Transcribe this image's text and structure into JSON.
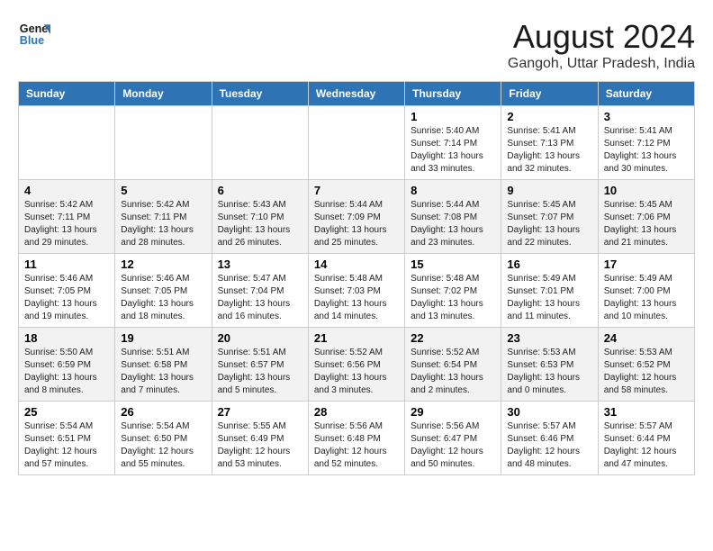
{
  "header": {
    "logo_text_general": "General",
    "logo_text_blue": "Blue",
    "month_year": "August 2024",
    "location": "Gangoh, Uttar Pradesh, India"
  },
  "weekdays": [
    "Sunday",
    "Monday",
    "Tuesday",
    "Wednesday",
    "Thursday",
    "Friday",
    "Saturday"
  ],
  "weeks": [
    [
      {
        "day": "",
        "info": ""
      },
      {
        "day": "",
        "info": ""
      },
      {
        "day": "",
        "info": ""
      },
      {
        "day": "",
        "info": ""
      },
      {
        "day": "1",
        "info": "Sunrise: 5:40 AM\nSunset: 7:14 PM\nDaylight: 13 hours\nand 33 minutes."
      },
      {
        "day": "2",
        "info": "Sunrise: 5:41 AM\nSunset: 7:13 PM\nDaylight: 13 hours\nand 32 minutes."
      },
      {
        "day": "3",
        "info": "Sunrise: 5:41 AM\nSunset: 7:12 PM\nDaylight: 13 hours\nand 30 minutes."
      }
    ],
    [
      {
        "day": "4",
        "info": "Sunrise: 5:42 AM\nSunset: 7:11 PM\nDaylight: 13 hours\nand 29 minutes."
      },
      {
        "day": "5",
        "info": "Sunrise: 5:42 AM\nSunset: 7:11 PM\nDaylight: 13 hours\nand 28 minutes."
      },
      {
        "day": "6",
        "info": "Sunrise: 5:43 AM\nSunset: 7:10 PM\nDaylight: 13 hours\nand 26 minutes."
      },
      {
        "day": "7",
        "info": "Sunrise: 5:44 AM\nSunset: 7:09 PM\nDaylight: 13 hours\nand 25 minutes."
      },
      {
        "day": "8",
        "info": "Sunrise: 5:44 AM\nSunset: 7:08 PM\nDaylight: 13 hours\nand 23 minutes."
      },
      {
        "day": "9",
        "info": "Sunrise: 5:45 AM\nSunset: 7:07 PM\nDaylight: 13 hours\nand 22 minutes."
      },
      {
        "day": "10",
        "info": "Sunrise: 5:45 AM\nSunset: 7:06 PM\nDaylight: 13 hours\nand 21 minutes."
      }
    ],
    [
      {
        "day": "11",
        "info": "Sunrise: 5:46 AM\nSunset: 7:05 PM\nDaylight: 13 hours\nand 19 minutes."
      },
      {
        "day": "12",
        "info": "Sunrise: 5:46 AM\nSunset: 7:05 PM\nDaylight: 13 hours\nand 18 minutes."
      },
      {
        "day": "13",
        "info": "Sunrise: 5:47 AM\nSunset: 7:04 PM\nDaylight: 13 hours\nand 16 minutes."
      },
      {
        "day": "14",
        "info": "Sunrise: 5:48 AM\nSunset: 7:03 PM\nDaylight: 13 hours\nand 14 minutes."
      },
      {
        "day": "15",
        "info": "Sunrise: 5:48 AM\nSunset: 7:02 PM\nDaylight: 13 hours\nand 13 minutes."
      },
      {
        "day": "16",
        "info": "Sunrise: 5:49 AM\nSunset: 7:01 PM\nDaylight: 13 hours\nand 11 minutes."
      },
      {
        "day": "17",
        "info": "Sunrise: 5:49 AM\nSunset: 7:00 PM\nDaylight: 13 hours\nand 10 minutes."
      }
    ],
    [
      {
        "day": "18",
        "info": "Sunrise: 5:50 AM\nSunset: 6:59 PM\nDaylight: 13 hours\nand 8 minutes."
      },
      {
        "day": "19",
        "info": "Sunrise: 5:51 AM\nSunset: 6:58 PM\nDaylight: 13 hours\nand 7 minutes."
      },
      {
        "day": "20",
        "info": "Sunrise: 5:51 AM\nSunset: 6:57 PM\nDaylight: 13 hours\nand 5 minutes."
      },
      {
        "day": "21",
        "info": "Sunrise: 5:52 AM\nSunset: 6:56 PM\nDaylight: 13 hours\nand 3 minutes."
      },
      {
        "day": "22",
        "info": "Sunrise: 5:52 AM\nSunset: 6:54 PM\nDaylight: 13 hours\nand 2 minutes."
      },
      {
        "day": "23",
        "info": "Sunrise: 5:53 AM\nSunset: 6:53 PM\nDaylight: 13 hours\nand 0 minutes."
      },
      {
        "day": "24",
        "info": "Sunrise: 5:53 AM\nSunset: 6:52 PM\nDaylight: 12 hours\nand 58 minutes."
      }
    ],
    [
      {
        "day": "25",
        "info": "Sunrise: 5:54 AM\nSunset: 6:51 PM\nDaylight: 12 hours\nand 57 minutes."
      },
      {
        "day": "26",
        "info": "Sunrise: 5:54 AM\nSunset: 6:50 PM\nDaylight: 12 hours\nand 55 minutes."
      },
      {
        "day": "27",
        "info": "Sunrise: 5:55 AM\nSunset: 6:49 PM\nDaylight: 12 hours\nand 53 minutes."
      },
      {
        "day": "28",
        "info": "Sunrise: 5:56 AM\nSunset: 6:48 PM\nDaylight: 12 hours\nand 52 minutes."
      },
      {
        "day": "29",
        "info": "Sunrise: 5:56 AM\nSunset: 6:47 PM\nDaylight: 12 hours\nand 50 minutes."
      },
      {
        "day": "30",
        "info": "Sunrise: 5:57 AM\nSunset: 6:46 PM\nDaylight: 12 hours\nand 48 minutes."
      },
      {
        "day": "31",
        "info": "Sunrise: 5:57 AM\nSunset: 6:44 PM\nDaylight: 12 hours\nand 47 minutes."
      }
    ]
  ]
}
